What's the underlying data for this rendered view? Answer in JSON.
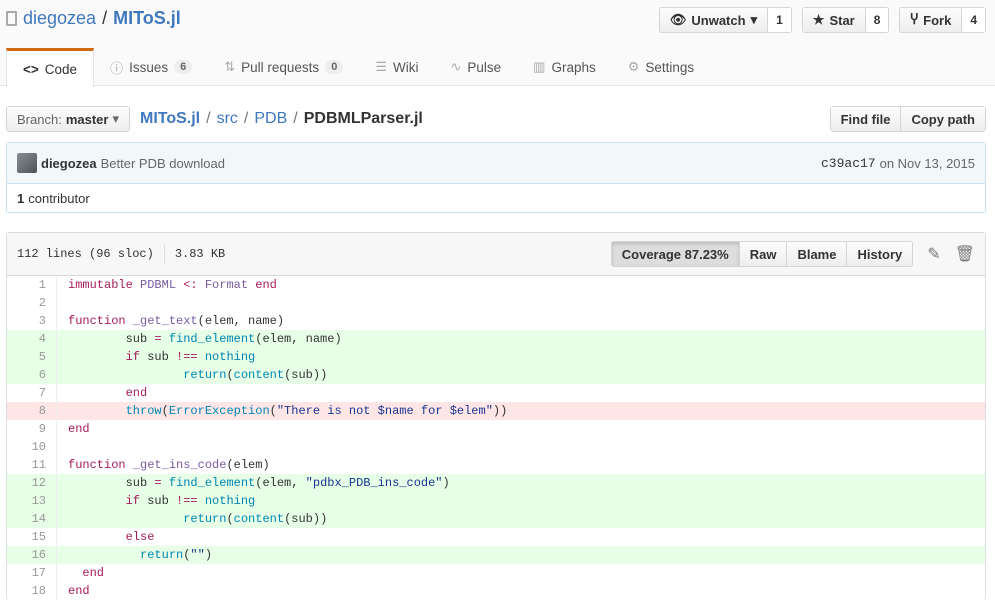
{
  "repo": {
    "owner": "diegozea",
    "sep": "/",
    "name": "MIToS.jl"
  },
  "actions": [
    {
      "label": "Unwatch",
      "icon": "eye-icon",
      "count": "1"
    },
    {
      "label": "Star",
      "icon": "star-icon",
      "count": "8"
    },
    {
      "label": "Fork",
      "icon": "fork-icon",
      "count": "4"
    }
  ],
  "tabs": [
    {
      "label": "Code",
      "icon": "code-icon"
    },
    {
      "label": "Issues",
      "icon": "issue-icon",
      "count": "6"
    },
    {
      "label": "Pull requests",
      "icon": "pull-request-icon",
      "count": "0"
    },
    {
      "label": "Wiki",
      "icon": "book-icon"
    },
    {
      "label": "Pulse",
      "icon": "pulse-icon"
    },
    {
      "label": "Graphs",
      "icon": "graph-icon"
    },
    {
      "label": "Settings",
      "icon": "gear-icon"
    }
  ],
  "branch": {
    "label": "Branch:",
    "value": "master"
  },
  "path": [
    "MIToS.jl",
    "src",
    "PDB",
    "PDBMLParser.jl"
  ],
  "find_file": "Find file",
  "copy_path": "Copy path",
  "commit": {
    "author": "diegozea",
    "message": "Better PDB download",
    "sha": "c39ac17",
    "date": "on Nov 13, 2015",
    "contributors_count": "1",
    "contributors_label": "contributor"
  },
  "file": {
    "lines_info": "112 lines (96 sloc)",
    "size": "3.83 KB",
    "coverage": "Coverage 87.23%",
    "raw": "Raw",
    "blame": "Blame",
    "history": "History"
  },
  "colors": {
    "accent": "#4078c0",
    "tab_active": "#d26911",
    "covered": "#e6ffe6",
    "uncovered": "#ffe6e6"
  },
  "code": {
    "lines": [
      {
        "n": "1",
        "cov": null,
        "t": [
          [
            "kw",
            "immutable "
          ],
          [
            "ty",
            "PDBML "
          ],
          [
            "kw",
            "<: "
          ],
          [
            "ty",
            "Format "
          ],
          [
            "kw",
            "end"
          ]
        ]
      },
      {
        "n": "2",
        "cov": null,
        "t": []
      },
      {
        "n": "3",
        "cov": null,
        "t": [
          [
            "kw",
            "function "
          ],
          [
            "ty",
            "_get_text"
          ],
          [
            "pl",
            "(elem, name)"
          ]
        ]
      },
      {
        "n": "4",
        "cov": "hit",
        "t": [
          [
            "pl",
            "        sub "
          ],
          [
            "kw",
            "= "
          ],
          [
            "fn",
            "find_element"
          ],
          [
            "pl",
            "(elem, name)"
          ]
        ]
      },
      {
        "n": "5",
        "cov": "hit",
        "t": [
          [
            "kw",
            "        if "
          ],
          [
            "pl",
            "sub "
          ],
          [
            "kw",
            "!== "
          ],
          [
            "fn",
            "nothing"
          ]
        ]
      },
      {
        "n": "6",
        "cov": "hit",
        "t": [
          [
            "fn",
            "                return"
          ],
          [
            "pl",
            "("
          ],
          [
            "fn",
            "content"
          ],
          [
            "pl",
            "(sub))"
          ]
        ]
      },
      {
        "n": "7",
        "cov": null,
        "t": [
          [
            "kw",
            "        end"
          ]
        ]
      },
      {
        "n": "8",
        "cov": "miss",
        "t": [
          [
            "fn",
            "        throw"
          ],
          [
            "pl",
            "("
          ],
          [
            "fn",
            "ErrorException"
          ],
          [
            "pl",
            "("
          ],
          [
            "st",
            "\"There is not $name for $elem\""
          ],
          [
            "pl",
            "))"
          ]
        ]
      },
      {
        "n": "9",
        "cov": null,
        "t": [
          [
            "kw",
            "end"
          ]
        ]
      },
      {
        "n": "10",
        "cov": null,
        "t": []
      },
      {
        "n": "11",
        "cov": null,
        "t": [
          [
            "kw",
            "function "
          ],
          [
            "ty",
            "_get_ins_code"
          ],
          [
            "pl",
            "(elem)"
          ]
        ]
      },
      {
        "n": "12",
        "cov": "hit",
        "t": [
          [
            "pl",
            "        sub "
          ],
          [
            "kw",
            "= "
          ],
          [
            "fn",
            "find_element"
          ],
          [
            "pl",
            "(elem, "
          ],
          [
            "st",
            "\"pdbx_PDB_ins_code\""
          ],
          [
            "pl",
            ")"
          ]
        ]
      },
      {
        "n": "13",
        "cov": "hit",
        "t": [
          [
            "kw",
            "        if "
          ],
          [
            "pl",
            "sub "
          ],
          [
            "kw",
            "!== "
          ],
          [
            "fn",
            "nothing"
          ]
        ]
      },
      {
        "n": "14",
        "cov": "hit",
        "t": [
          [
            "fn",
            "                return"
          ],
          [
            "pl",
            "("
          ],
          [
            "fn",
            "content"
          ],
          [
            "pl",
            "(sub))"
          ]
        ]
      },
      {
        "n": "15",
        "cov": null,
        "t": [
          [
            "kw",
            "        else"
          ]
        ]
      },
      {
        "n": "16",
        "cov": "hit",
        "t": [
          [
            "fn",
            "          return"
          ],
          [
            "pl",
            "("
          ],
          [
            "st",
            "\"\""
          ],
          [
            "pl",
            ")"
          ]
        ]
      },
      {
        "n": "17",
        "cov": null,
        "t": [
          [
            "kw",
            "  end"
          ]
        ]
      },
      {
        "n": "18",
        "cov": null,
        "t": [
          [
            "kw",
            "end"
          ]
        ]
      }
    ]
  }
}
